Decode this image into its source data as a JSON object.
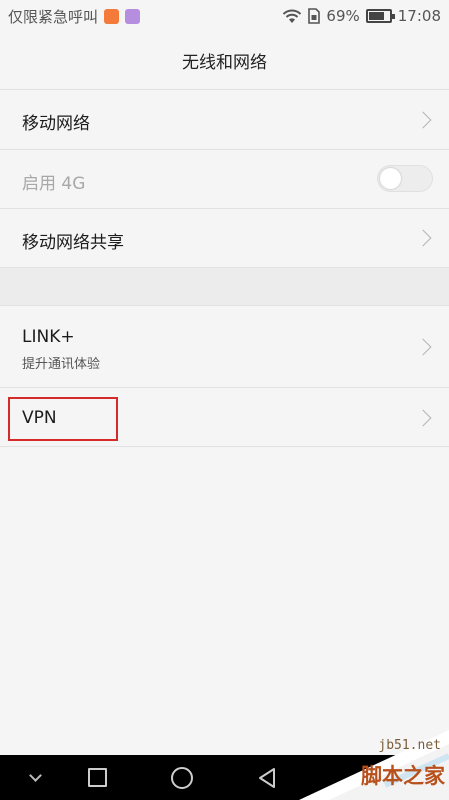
{
  "status_bar": {
    "carrier": "仅限紧急呼叫",
    "battery_percent": "69%",
    "battery_level": 0.69,
    "time": "17:08",
    "icons": [
      "notification-orange-icon",
      "notification-purple-icon",
      "wifi-icon",
      "sim-icon",
      "battery-icon"
    ]
  },
  "header": {
    "title": "无线和网络"
  },
  "settings": {
    "mobile_network": {
      "label": "移动网络"
    },
    "enable_4g": {
      "label": "启用 4G",
      "enabled": false,
      "toggle_on": false
    },
    "tethering": {
      "label": "移动网络共享"
    },
    "link_plus": {
      "label": "LINK+",
      "subtitle": "提升通讯体验"
    },
    "vpn": {
      "label": "VPN"
    }
  },
  "highlight": {
    "color": "#d42a2a",
    "target": "vpn"
  },
  "nav_bar": {
    "buttons": [
      "hide-nav-icon",
      "recents-icon",
      "home-icon",
      "back-icon"
    ]
  },
  "watermark": {
    "url": "jb51.net",
    "name": "脚本之家"
  },
  "colors": {
    "background": "#f5f5f5",
    "divider": "#e2e2e2",
    "text_primary": "#1c1c1c",
    "text_disabled": "#a8a8a8",
    "nav_bar": "#000000"
  }
}
